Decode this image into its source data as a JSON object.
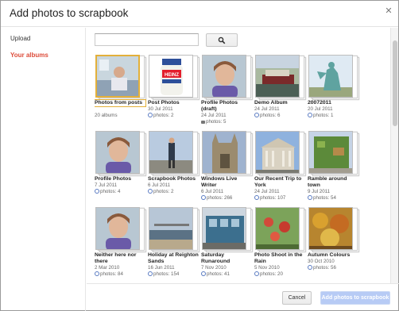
{
  "dialog": {
    "title": "Add photos to scrapbook",
    "close_icon": "close-icon"
  },
  "sidebar": {
    "items": [
      {
        "label": "Upload",
        "active": false
      },
      {
        "label": "Your albums",
        "active": true
      }
    ]
  },
  "search": {
    "value": "",
    "button_icon": "search-icon"
  },
  "albums": [
    {
      "name": "Photos from posts",
      "date": "",
      "count": "20 albums",
      "count_icon": "",
      "selected": true,
      "theme": "hospital"
    },
    {
      "name": "Post Photos",
      "date": "30 Jul 2011",
      "count": "photos: 2",
      "count_icon": "photos-icon",
      "selected": false,
      "theme": "jar"
    },
    {
      "name": "Profile Photos (draft)",
      "date": "24 Jul 2011",
      "count": "photos: 5",
      "count_icon": "lock-icon",
      "selected": false,
      "theme": "portrait"
    },
    {
      "name": "Demo Album",
      "date": "24 Jul 2011",
      "count": "photos: 6",
      "count_icon": "photos-icon",
      "selected": false,
      "theme": "boat"
    },
    {
      "name": "20072011",
      "date": "20 Jul 2011",
      "count": "photos: 1",
      "count_icon": "photos-icon",
      "selected": false,
      "theme": "statue"
    },
    {
      "name": "Profile Photos",
      "date": "7 Jul 2011",
      "count": "photos: 4",
      "count_icon": "photos-icon",
      "selected": false,
      "theme": "portrait"
    },
    {
      "name": "Scrapbook Photos",
      "date": "6 Jul 2011",
      "count": "photos: 2",
      "count_icon": "photos-icon",
      "selected": false,
      "theme": "person"
    },
    {
      "name": "Windows Live Writer",
      "date": "6 Jul 2011",
      "count": "photos: 266",
      "count_icon": "photos-icon",
      "selected": false,
      "theme": "cathedral"
    },
    {
      "name": "Our Recent Trip to York",
      "date": "24 Jul 2011",
      "count": "photos: 107",
      "count_icon": "photos-icon",
      "selected": false,
      "theme": "building"
    },
    {
      "name": "Ramble around town",
      "date": "9 Jul 2011",
      "count": "photos: 54",
      "count_icon": "photos-icon",
      "selected": false,
      "theme": "garden"
    },
    {
      "name": "Neither here nor there",
      "date": "2 Mar 2010",
      "count": "photos: 84",
      "count_icon": "photos-icon",
      "selected": false,
      "theme": "portrait"
    },
    {
      "name": "Holiday at Reighton Sands",
      "date": "16 Jun 2011",
      "count": "photos: 154",
      "count_icon": "photos-icon",
      "selected": false,
      "theme": "sea"
    },
    {
      "name": "Saturday Runaround",
      "date": "7 Nov 2010",
      "count": "photos: 41",
      "count_icon": "photos-icon",
      "selected": false,
      "theme": "tram"
    },
    {
      "name": "Photo Shoot in the Rain",
      "date": "5 Nov 2010",
      "count": "photos: 20",
      "count_icon": "photos-icon",
      "selected": false,
      "theme": "flowers"
    },
    {
      "name": "Autumn Colours",
      "date": "30 Oct 2010",
      "count": "photos: 56",
      "count_icon": "photos-icon",
      "selected": false,
      "theme": "autumn"
    }
  ],
  "footer": {
    "cancel_label": "Cancel",
    "add_label": "Add photos to scrapbook"
  },
  "colors": {
    "accent_red": "#dd4b39",
    "selected_border": "#e3b03a",
    "primary_disabled": "#b7cbf5"
  }
}
